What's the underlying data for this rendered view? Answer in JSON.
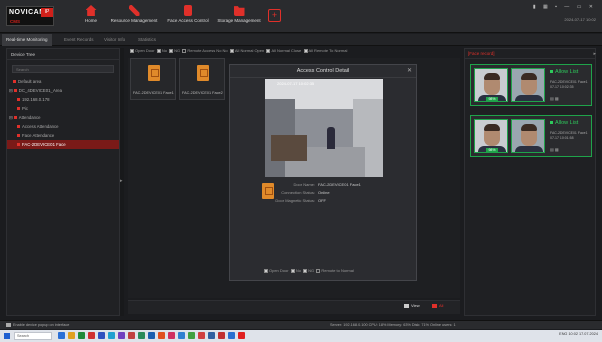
{
  "app": {
    "logo_brand": "NOVICAM",
    "logo_badge": "IP",
    "logo_sub": "CMS"
  },
  "nav": [
    {
      "label": "Home"
    },
    {
      "label": "Resource Management"
    },
    {
      "label": "Face Access Control"
    },
    {
      "label": "Storage Management"
    }
  ],
  "add_tab": "+",
  "window_controls": "▮ ▦ ▪ — ▭ ✕",
  "clock": "2024-07-17 10:02",
  "tabs": [
    "Real-time Monitoring",
    "Event Records",
    "Visitor Info",
    "Statistics"
  ],
  "left_panel": {
    "title": "Device Tree",
    "search_placeholder": "Search",
    "items": [
      {
        "label": "Default area",
        "level": 0,
        "selected": false
      },
      {
        "label": "DC_4DEVICE01_Area",
        "level": 0,
        "selected": false
      },
      {
        "label": "192.168.0.178",
        "level": 1,
        "selected": false
      },
      {
        "label": "Pic",
        "level": 1,
        "selected": false
      },
      {
        "label": "Attendance",
        "level": 0,
        "selected": false
      },
      {
        "label": "Access Attendance",
        "level": 1,
        "selected": false
      },
      {
        "label": "Face Attendance",
        "level": 1,
        "selected": false
      },
      {
        "label": "FAC-2DEVICE01 Face",
        "level": 1,
        "selected": true
      }
    ]
  },
  "filters": [
    {
      "label": "Open Door",
      "checked": true
    },
    {
      "label": "No",
      "checked": true
    },
    {
      "label": "NG",
      "checked": true
    },
    {
      "label": "Remote Access No No",
      "checked": false
    },
    {
      "label": "All Normal Open",
      "checked": true
    },
    {
      "label": "All Normal Close",
      "checked": true
    },
    {
      "label": "All Remote To Normal",
      "checked": true
    }
  ],
  "thumbnails": [
    {
      "label": "FAC-2DEVICE01 Face1"
    },
    {
      "label": "FAC-2DEVICE01 Face2"
    }
  ],
  "dialog": {
    "title": "Access Control Detail",
    "close": "✕",
    "camera_stamp": "2024-07-17 10:02:35",
    "fields": [
      {
        "key": "Door Name:",
        "value": "FAC-2DEVICE01 Face1"
      },
      {
        "key": "Connection Status:",
        "value": "Online"
      },
      {
        "key": "Door Magnetic Status:",
        "value": "OFF"
      }
    ],
    "footer": [
      {
        "label": "Open Door",
        "checked": true
      },
      {
        "label": "No",
        "checked": true
      },
      {
        "label": "NG",
        "checked": true
      },
      {
        "label": "Remote to Normal",
        "checked": false
      }
    ]
  },
  "center_buttons": {
    "view": "View",
    "all": "All"
  },
  "right_panel": {
    "title": "[Face record]",
    "cards": [
      {
        "status": "Allow List",
        "badge": "98%",
        "name": "FAC-2DEVICE01 Face1",
        "time": "07-17 10:02:35"
      },
      {
        "status": "Allow List",
        "badge": "98%",
        "name": "FAC-2DEVICE01 Face1",
        "time": "07-17 10:01:58"
      }
    ]
  },
  "statusbar": {
    "message": "Enable device popup on interface",
    "info": "Server: 192.168.0.100   CPU: 18%   Memory: 63%   Disk: 71%   Online users: 1"
  },
  "taskbar": {
    "search": "Search",
    "tray": "ENG  10:02  17.07.2024"
  },
  "colors": {
    "accent": "#e0302a",
    "allow": "#2ec95c",
    "card_border": "#1fa34a",
    "background": "#1b1c1f"
  }
}
